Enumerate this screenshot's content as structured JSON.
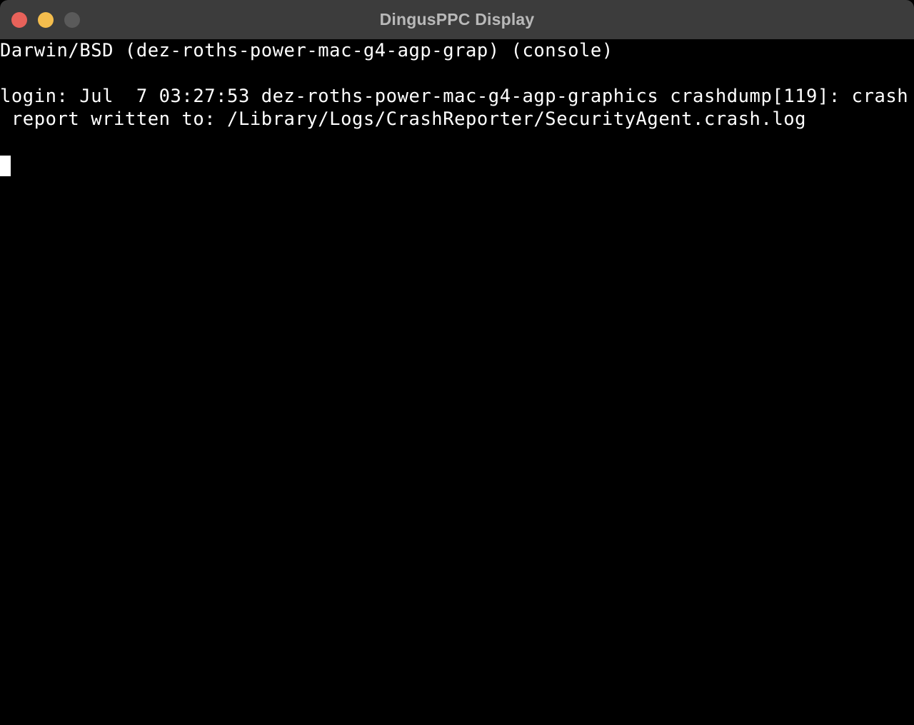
{
  "window": {
    "title": "DingusPPC Display",
    "titlebar_color": "#3c3c3c",
    "title_text_color": "#b9b9b9",
    "screen_background": "#000000",
    "text_color": "#ffffff",
    "controls": [
      {
        "name": "close",
        "label": "Close",
        "color": "#e8625a"
      },
      {
        "name": "minimize",
        "label": "Minimize",
        "color": "#f4bd4d"
      },
      {
        "name": "zoom",
        "label": "Zoom",
        "color": "#5a5a5a"
      }
    ]
  },
  "console": {
    "lines": [
      "Darwin/BSD (dez-roths-power-mac-g4-agp-grap) (console)",
      "",
      "login: Jul  7 03:27:53 dez-roths-power-mac-g4-agp-graphics crashdump[119]: crash",
      " report written to: /Library/Logs/CrashReporter/SecurityAgent.crash.log"
    ],
    "line_1": "Darwin/BSD (dez-roths-power-mac-g4-agp-grap) (console)",
    "line_2": "",
    "line_3": "login: Jul  7 03:27:53 dez-roths-power-mac-g4-agp-graphics crashdump[119]: crash",
    "line_4": " report written to: /Library/Logs/CrashReporter/SecurityAgent.crash.log",
    "cursor": "block-cursor"
  }
}
